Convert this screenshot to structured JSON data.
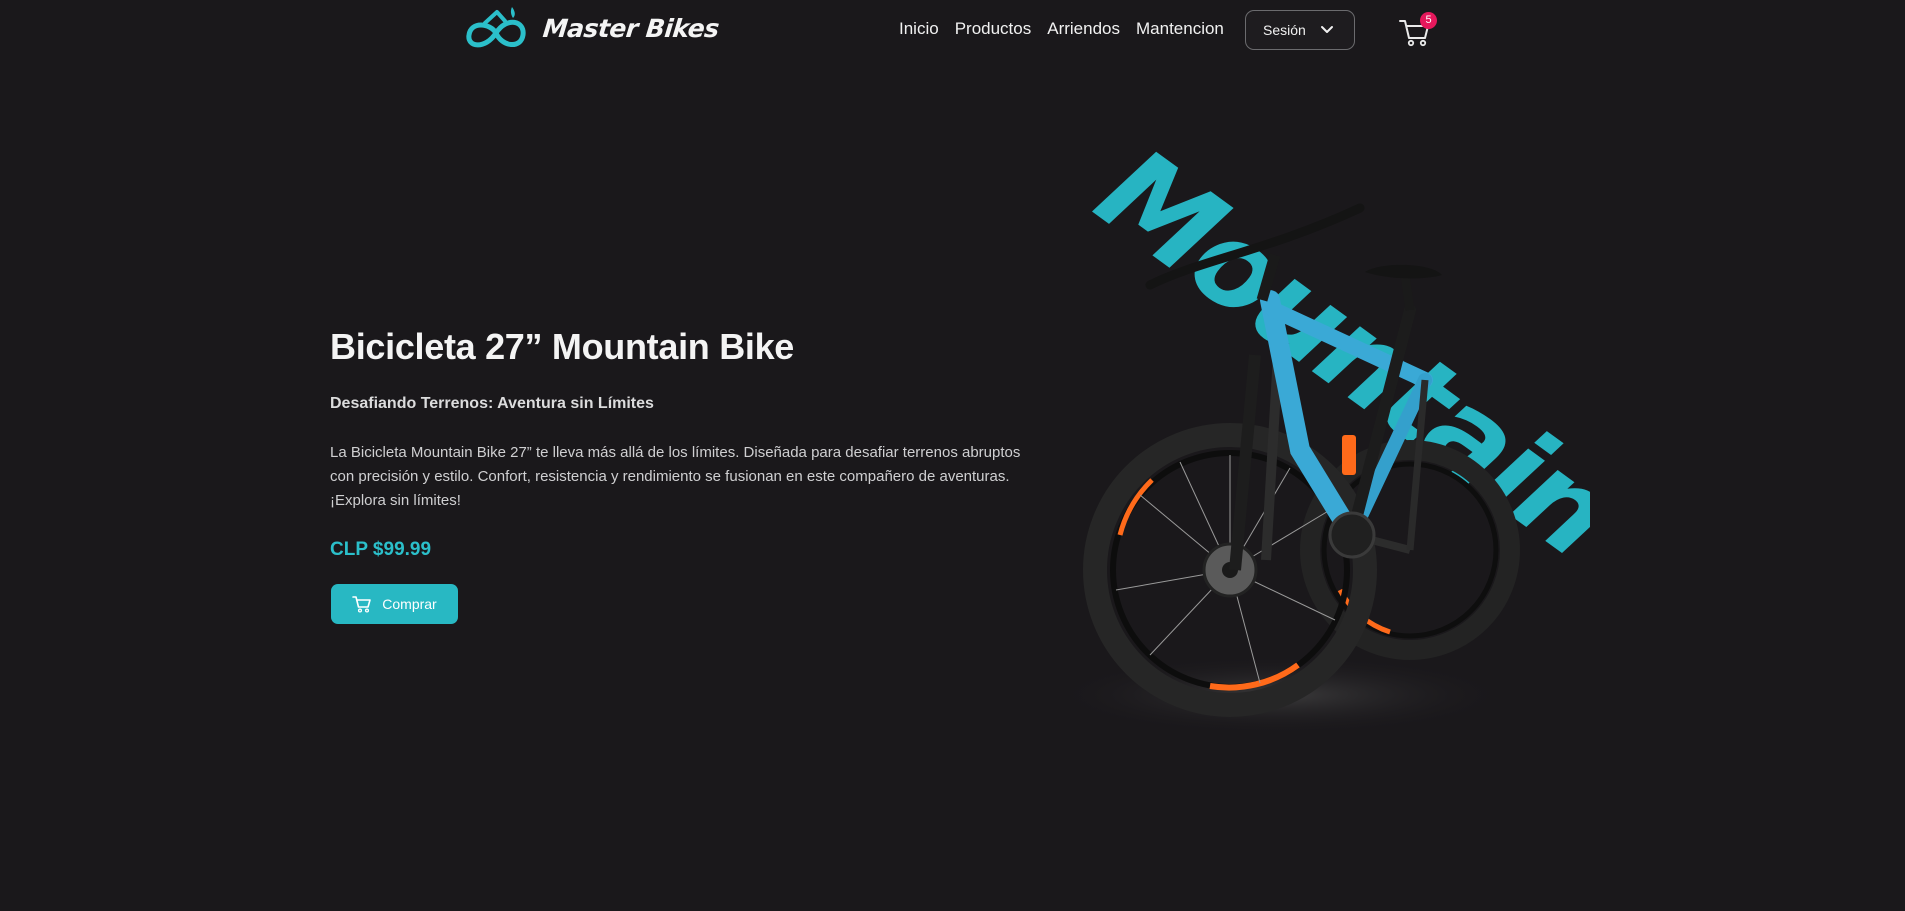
{
  "brand": {
    "name": "Master Bikes",
    "logo_icon": "bike-logo-icon"
  },
  "nav": {
    "items": [
      {
        "label": "Inicio"
      },
      {
        "label": "Productos"
      },
      {
        "label": "Arriendos"
      },
      {
        "label": "Mantencion"
      }
    ],
    "session_label": "Sesión",
    "cart_count": "5"
  },
  "hero": {
    "title": "Bicicleta 27” Mountain Bike",
    "subtitle": "Desafiando Terrenos: Aventura sin Límites",
    "description": "La Bicicleta Mountain Bike 27” te lleva más allá de los límites. Diseñada para desafiar terrenos abruptos con precisión y estilo. Confort, resistencia y rendimiento se fusionan en este compañero de aventuras. ¡Explora sin límites!",
    "price": "CLP $99.99",
    "buy_label": "Comprar",
    "image_word": "Mountain"
  },
  "colors": {
    "background": "#1a181b",
    "accent": "#28b8c3",
    "badge": "#e6185c",
    "bike_frame": "#3aa9d6",
    "bike_highlight": "#ff6a1a"
  }
}
